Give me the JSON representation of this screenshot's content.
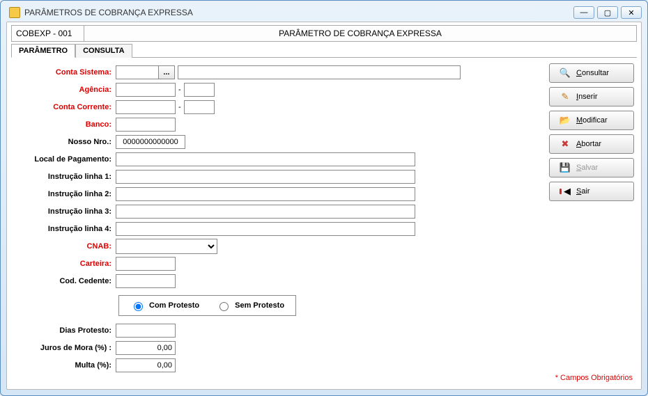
{
  "window": {
    "title": "PARÂMETROS DE COBRANÇA EXPRESSA"
  },
  "header": {
    "code": "COBEXP - 001",
    "title": "PARÂMETRO DE COBRANÇA EXPRESSA"
  },
  "tabs": {
    "parametro": "PARÂMETRO",
    "consulta": "CONSULTA"
  },
  "labels": {
    "conta_sistema": "Conta Sistema:",
    "agencia": "Agência:",
    "conta_corrente": "Conta Corrente:",
    "banco": "Banco:",
    "nosso_nro": "Nosso Nro.:",
    "local_pagamento": "Local de Pagamento:",
    "instrucao1": "Instrução linha 1:",
    "instrucao2": "Instrução linha 2:",
    "instrucao3": "Instrução linha 3:",
    "instrucao4": "Instrução linha 4:",
    "cnab": "CNAB:",
    "carteira": "Carteira:",
    "cod_cedente": "Cod. Cedente:",
    "dias_protesto": "Dias Protesto:",
    "juros_mora": "Juros de Mora (%)  :",
    "multa": "Multa (%):",
    "com_protesto": "Com Protesto",
    "sem_protesto": "Sem Protesto"
  },
  "values": {
    "conta_sistema": "",
    "conta_sistema_desc": "",
    "agencia": "",
    "agencia_dig": "",
    "conta_corrente": "",
    "conta_corrente_dig": "",
    "banco": "",
    "nosso_nro": "0000000000000",
    "local_pagamento": "",
    "instrucao1": "",
    "instrucao2": "",
    "instrucao3": "",
    "instrucao4": "",
    "cnab": "",
    "carteira": "",
    "cod_cedente": "",
    "dias_protesto": "",
    "juros_mora": "0,00",
    "multa": "0,00",
    "protesto": "com"
  },
  "buttons": {
    "consultar": "Consultar",
    "inserir": "Inserir",
    "modificar": "Modificar",
    "abortar": "Abortar",
    "salvar": "Salvar",
    "sair": "Sair"
  },
  "footer": {
    "mandatory": "* Campos Obrigatórios"
  },
  "win_controls": {
    "min": "—",
    "max": "▢",
    "close": "✕"
  }
}
